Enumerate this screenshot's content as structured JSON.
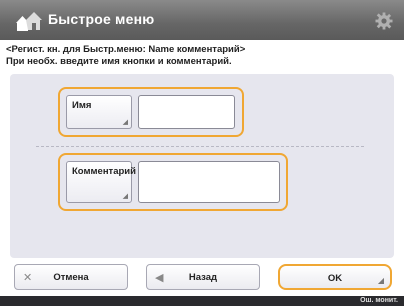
{
  "header": {
    "title": "Быстрое меню",
    "home_icon": "home-icon",
    "settings_icon": "gear-icon"
  },
  "instruction": {
    "line1": "<Регист. кн. для Быстр.меню: Name комментарий>",
    "line2": "При необх. введите имя кнопки и комментарий."
  },
  "form": {
    "name_button_label": "Имя",
    "name_value": "",
    "comment_button_label": "Комментарий",
    "comment_value": ""
  },
  "footer": {
    "cancel_label": "Отмена",
    "back_label": "Назад",
    "ok_label": "OK"
  },
  "status": {
    "text": "Ош. монит."
  },
  "colors": {
    "accent": "#f0a733",
    "titlebar": "#666666",
    "panel": "#e6e6ee"
  }
}
